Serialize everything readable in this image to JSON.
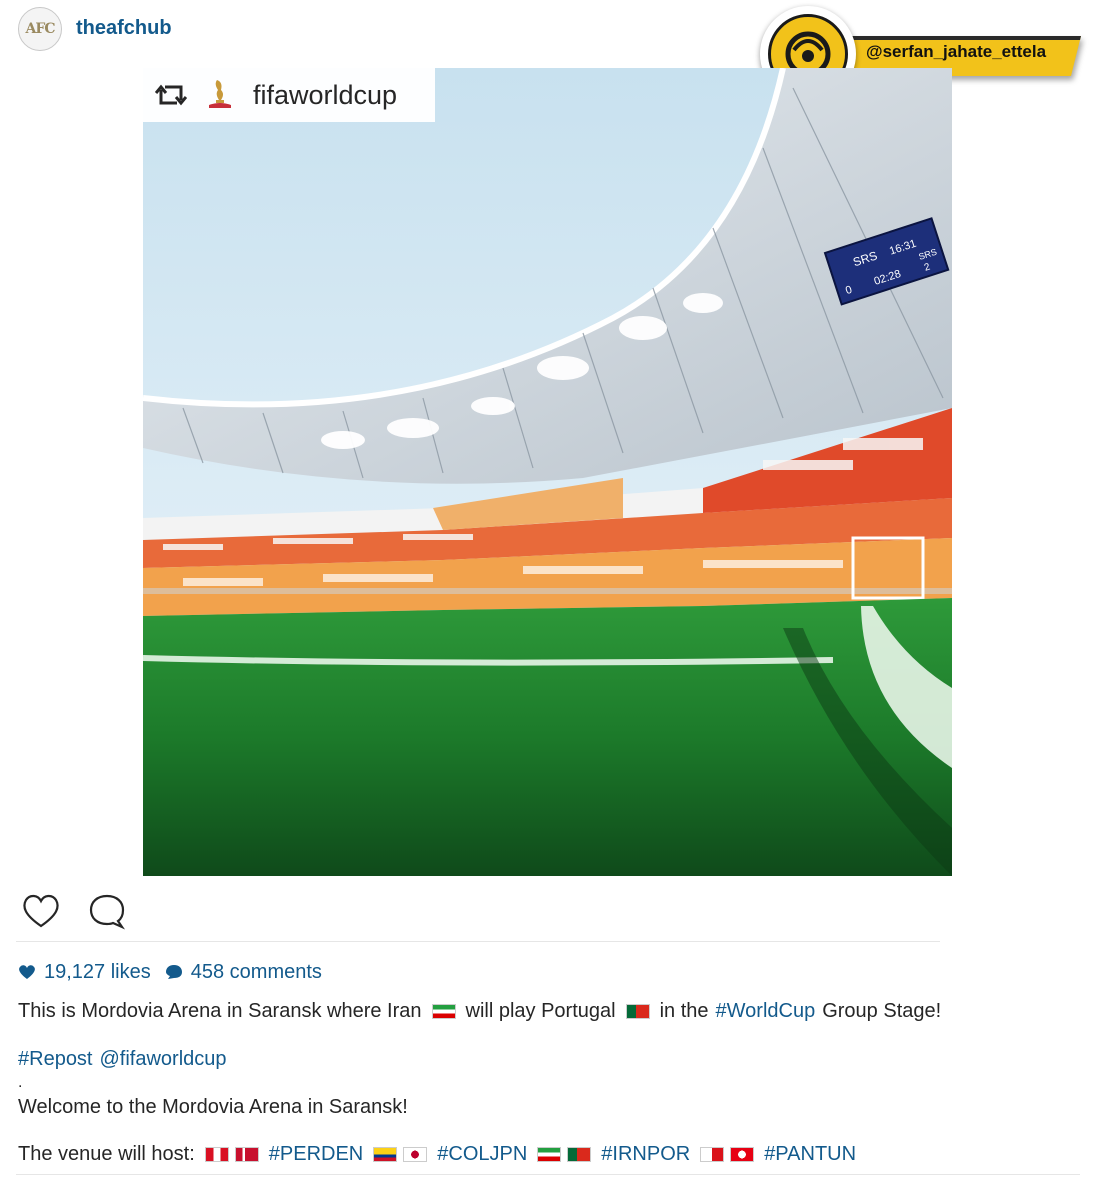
{
  "header": {
    "avatar_text": "AFC",
    "username": "theafchub"
  },
  "watermark": {
    "handle": "@serfan_jahate_ettela"
  },
  "post": {
    "repost_username": "fifaworldcup",
    "photo_icon": "stadium-photo",
    "scoreboard": {
      "team_left": "SRS",
      "team_right": "SRS",
      "time": "16:31",
      "clock": "02:28",
      "score_left": "0",
      "score_right": "2"
    }
  },
  "actions": {
    "like_icon": "heart-icon",
    "comment_icon": "comment-bubble-icon"
  },
  "stats": {
    "likes": "19,127 likes",
    "comments": "458 comments"
  },
  "caption": {
    "line1_a": "This is Mordovia Arena in Saransk where Iran",
    "line1_b": "will play Portugal",
    "line1_c": "in the",
    "line1_tag": "#WorldCup",
    "line1_d": "Group Stage!",
    "repost_tag": "#Repost",
    "repost_mention": "@fifaworldcup",
    "dot": ".",
    "welcome": "Welcome to the Mordovia Arena in Saransk!",
    "venue_prefix": "The venue will host:",
    "tag_perden": "#PERDEN",
    "tag_coljpn": "#COLJPN",
    "tag_irnpor": "#IRNPOR",
    "tag_pantun": "#PANTUN"
  },
  "colors": {
    "link": "#135a8c",
    "text": "#262626",
    "watermark_yellow": "#f2c21a"
  }
}
